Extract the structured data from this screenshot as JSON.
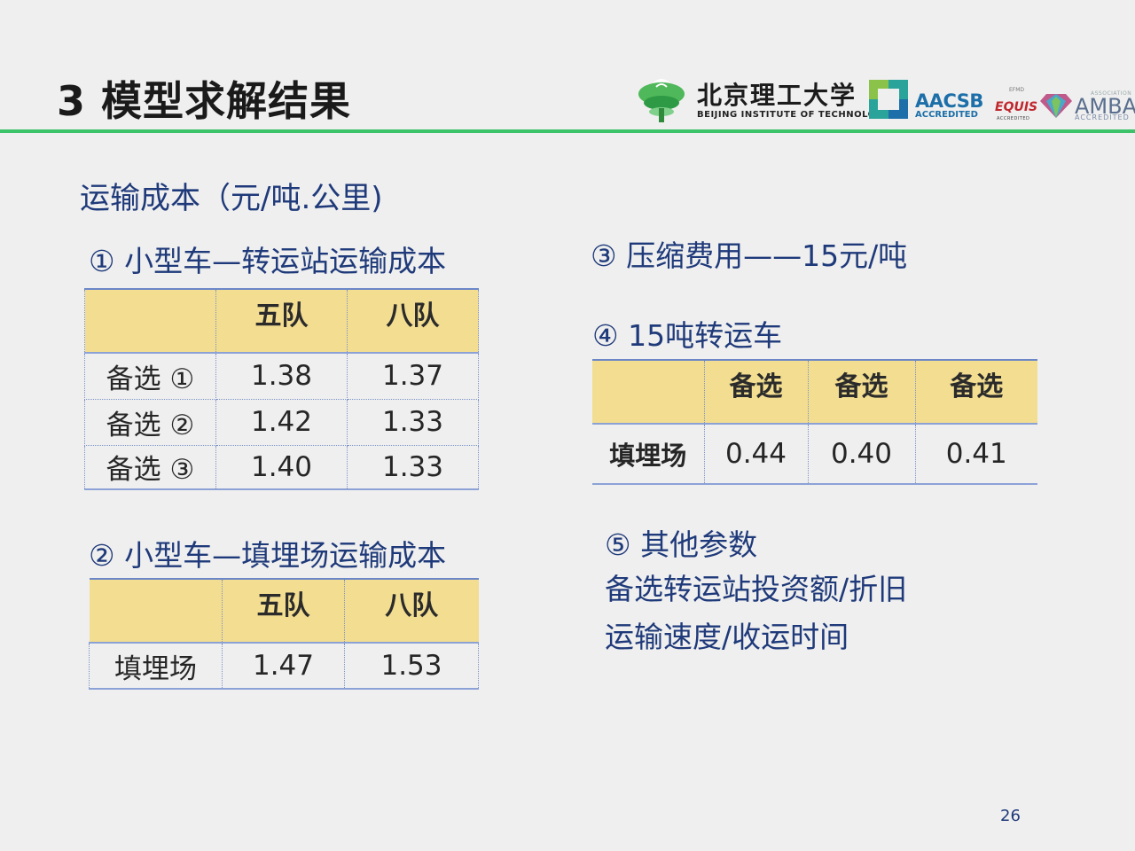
{
  "header": {
    "title": "3 模型求解结果",
    "logos": {
      "bit_cn": "北京理工大学",
      "bit_en": "BEIJING INSTITUTE OF TECHNOLOGY",
      "aacsb": "AACSB",
      "aacsb_sub": "ACCREDITED",
      "efmd": "EFMD",
      "equis": "EQUIS",
      "equis_sub": "ACCREDITED",
      "amba_assoc": "ASSOCIATION",
      "amba": "AMBA",
      "amba_sub": "ACCREDITED"
    },
    "accent_color": "#3cc36a"
  },
  "section_heading": "运输成本（元/吨.公里)",
  "table1": {
    "title": "① 小型车—转运站运输成本",
    "headers": [
      "",
      "五队",
      "八队"
    ],
    "rows": [
      {
        "label": "备选 ①",
        "values": [
          "1.38",
          "1.37"
        ]
      },
      {
        "label": "备选 ②",
        "values": [
          "1.42",
          "1.33"
        ]
      },
      {
        "label": "备选 ③",
        "values": [
          "1.40",
          "1.33"
        ]
      }
    ]
  },
  "table2": {
    "title": "② 小型车—填埋场运输成本",
    "headers": [
      "",
      "五队",
      "八队"
    ],
    "rows": [
      {
        "label": "填埋场",
        "values": [
          "1.47",
          "1.53"
        ]
      }
    ]
  },
  "compress": "③ 压缩费用——15元/吨",
  "table4": {
    "title": "④ 15吨转运车",
    "headers": [
      "",
      "备选",
      "备选",
      "备选"
    ],
    "rows": [
      {
        "label": "填埋场",
        "values": [
          "0.44",
          "0.40",
          "0.41"
        ]
      }
    ]
  },
  "other": {
    "title": "⑤  其他参数",
    "lines": [
      "备选转运站投资额/折旧",
      "运输速度/收运时间"
    ]
  },
  "page_number": "26",
  "colors": {
    "header_fill": "#f2dd90",
    "text_blue": "#1f3a7a",
    "border_blue": "#6b87c8"
  }
}
